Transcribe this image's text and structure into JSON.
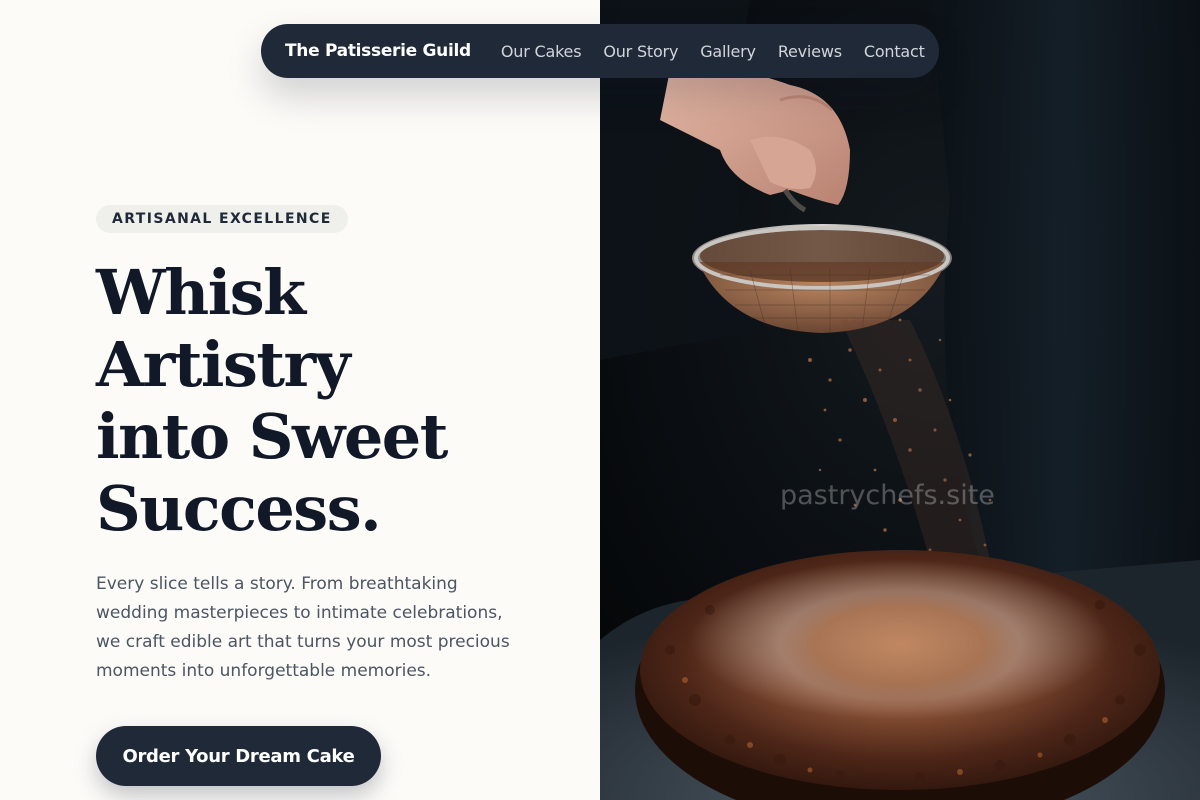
{
  "nav": {
    "brand": "The Patisserie Guild",
    "links": [
      "Our Cakes",
      "Our Story",
      "Gallery",
      "Reviews",
      "Contact"
    ]
  },
  "hero": {
    "badge": "ARTISANAL EXCELLENCE",
    "headline_lines": [
      "Whisk",
      "Artistry",
      "into Sweet",
      "Success."
    ],
    "description": "Every slice tells a story. From breathtaking wedding masterpieces to intimate celebrations, we craft edible art that turns your most precious moments into unforgettable memories.",
    "cta_label": "Order Your Dream Cake"
  },
  "image": {
    "subject": "hand sifting cocoa powder over a chocolate cake",
    "watermark": "pastrychefs.site"
  },
  "colors": {
    "background": "#fcfbf8",
    "navy": "#1f2937",
    "heading": "#111827",
    "body_text": "#4b5563"
  }
}
